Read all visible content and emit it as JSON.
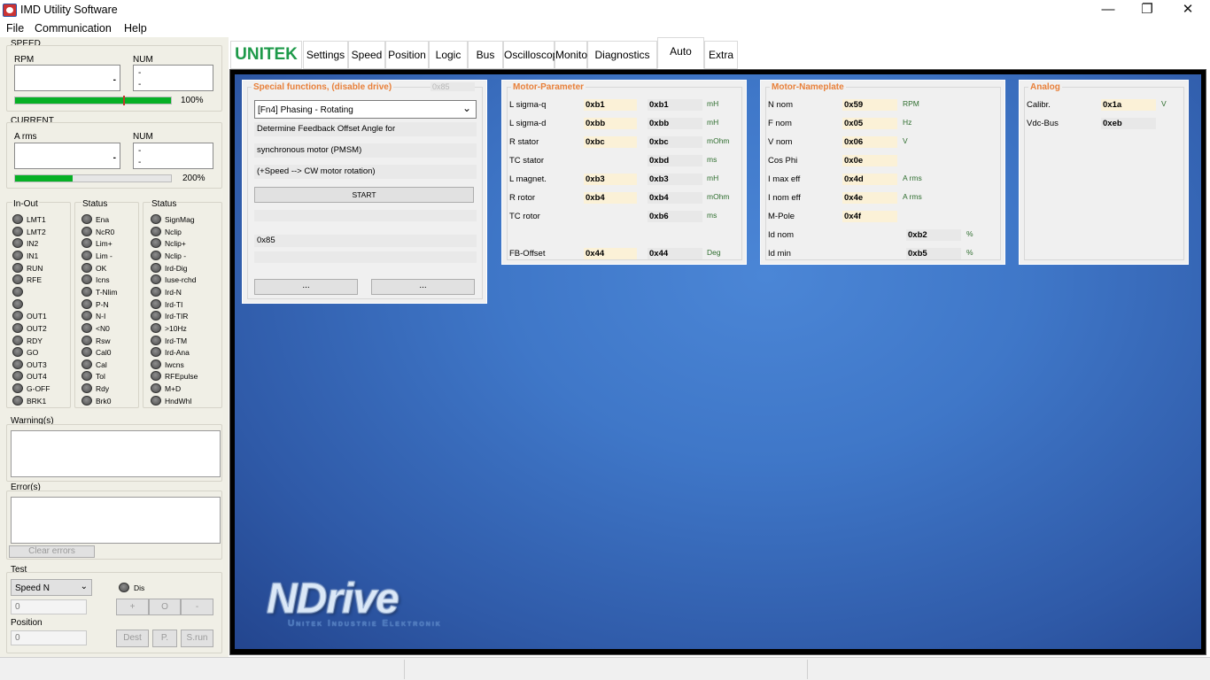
{
  "window": {
    "title": "IMD Utility Software",
    "minimize": "—",
    "restore": "❐",
    "close": "✕"
  },
  "menu": {
    "file": "File",
    "communication": "Communication",
    "help": "Help"
  },
  "speed": {
    "section": "SPEED",
    "rpm_label": "RPM",
    "num_label": "NUM",
    "rpm_value": "-",
    "num_line1": "-",
    "num_line2": "-",
    "bar_percent": "100%",
    "bar_fill_fraction": 1.0
  },
  "current": {
    "section": "CURRENT",
    "arms_label": "A rms",
    "num_label": "NUM",
    "arms_value": "-",
    "num_line1": "-",
    "num_line2": "-",
    "bar_percent": "200%",
    "bar_fill_fraction": 0.37
  },
  "io_groups": {
    "inout_title": "In-Out",
    "status_title": "Status",
    "status2_title": "Status",
    "inout": [
      "LMT1",
      "LMT2",
      "IN2",
      "IN1",
      "RUN",
      "RFE",
      "",
      "",
      "OUT1",
      "OUT2",
      "RDY",
      "GO",
      "OUT3",
      "OUT4",
      "G-OFF",
      "BRK1"
    ],
    "status": [
      "Ena",
      "NcR0",
      "Lim+",
      "Lim -",
      "OK",
      "Icns",
      "T-Nlim",
      "P-N",
      "N-I",
      "<N0",
      "Rsw",
      "Cal0",
      "Cal",
      "Tol",
      "Rdy",
      "Brk0"
    ],
    "status2": [
      "SignMag",
      "Nclip",
      "Nclip+",
      "Nclip -",
      "Ird-Dig",
      "Iuse-rchd",
      "Ird-N",
      "Ird-TI",
      "Ird-TIR",
      ">10Hz",
      "Ird-TM",
      "Ird-Ana",
      "Iwcns",
      "RFEpulse",
      "M+D",
      "HndWhl"
    ]
  },
  "warnings": {
    "label": "Warning(s)"
  },
  "errors": {
    "label": "Error(s)",
    "clear_button": "Clear errors"
  },
  "test": {
    "label": "Test",
    "mode_select": "Speed N",
    "dis_label": "Dis",
    "value": "0",
    "plus": "+",
    "zero": "O",
    "minus": "-",
    "position_label": "Position",
    "position_value": "0",
    "dest": "Dest",
    "p": "P.",
    "srun": "S.run"
  },
  "tabs": {
    "logo": "UNITEK",
    "items": [
      "Settings",
      "Speed",
      "Position",
      "Logic",
      "Bus",
      "Oscilloscope",
      "Monitor",
      "Diagnostics",
      "Auto",
      "Extra"
    ],
    "active": "Auto"
  },
  "special": {
    "title": "Special functions, (disable drive)",
    "disabled_field": "0x85",
    "select": "[Fn4] Phasing - Rotating",
    "line1": "Determine Feedback Offset Angle for",
    "line2": "synchronous motor (PMSM)",
    "line3": "(+Speed --> CW motor rotation)",
    "start": "START",
    "reg": "0x85",
    "btn1": "...",
    "btn2": "..."
  },
  "motor_param": {
    "title": "Motor-Parameter",
    "rows": [
      {
        "label": "L  sigma-q",
        "v1": "0xb1",
        "v2": "0xb1",
        "unit": "mH"
      },
      {
        "label": "L  sigma-d",
        "v1": "0xbb",
        "v2": "0xbb",
        "unit": "mH"
      },
      {
        "label": "R  stator",
        "v1": "0xbc",
        "v2": "0xbc",
        "unit": "mOhm"
      },
      {
        "label": "TC stator",
        "v1": "",
        "v2": "0xbd",
        "unit": "ms"
      },
      {
        "label": "L  magnet.",
        "v1": "0xb3",
        "v2": "0xb3",
        "unit": "mH"
      },
      {
        "label": "R  rotor",
        "v1": "0xb4",
        "v2": "0xb4",
        "unit": "mOhm"
      },
      {
        "label": "TC rotor",
        "v1": "",
        "v2": "0xb6",
        "unit": "ms"
      },
      {
        "label": "FB-Offset",
        "v1": "0x44",
        "v2": "0x44",
        "unit": "Deg"
      }
    ]
  },
  "nameplate": {
    "title": "Motor-Nameplate",
    "rows": [
      {
        "label": "N nom",
        "v1": "0x59",
        "v2": "",
        "unit": "RPM"
      },
      {
        "label": "F nom",
        "v1": "0x05",
        "v2": "",
        "unit": "Hz"
      },
      {
        "label": "V nom",
        "v1": "0x06",
        "v2": "",
        "unit": "V"
      },
      {
        "label": "Cos Phi",
        "v1": "0x0e",
        "v2": "",
        "unit": ""
      },
      {
        "label": "I max eff",
        "v1": "0x4d",
        "v2": "",
        "unit": "A rms"
      },
      {
        "label": "I nom eff",
        "v1": "0x4e",
        "v2": "",
        "unit": "A rms"
      },
      {
        "label": "M-Pole",
        "v1": "0x4f",
        "v2": "",
        "unit": ""
      },
      {
        "label": "Id nom",
        "v1": "",
        "v2": "0xb2",
        "unit": "%"
      },
      {
        "label": "Id min",
        "v1": "",
        "v2": "0xb5",
        "unit": "%"
      }
    ]
  },
  "analog": {
    "title": "Analog",
    "rows": [
      {
        "label": "Calibr.",
        "v1": "0x1a",
        "unit": "V"
      },
      {
        "label": "Vdc-Bus",
        "v1": "0xeb",
        "unit": ""
      }
    ]
  },
  "brand": {
    "logo": "NDrive",
    "sub": "Unitek Industrie Elektronik"
  },
  "colors": {
    "accent": "#e8803a",
    "bar": "#06b025",
    "background_blue": "#3f77c8"
  }
}
